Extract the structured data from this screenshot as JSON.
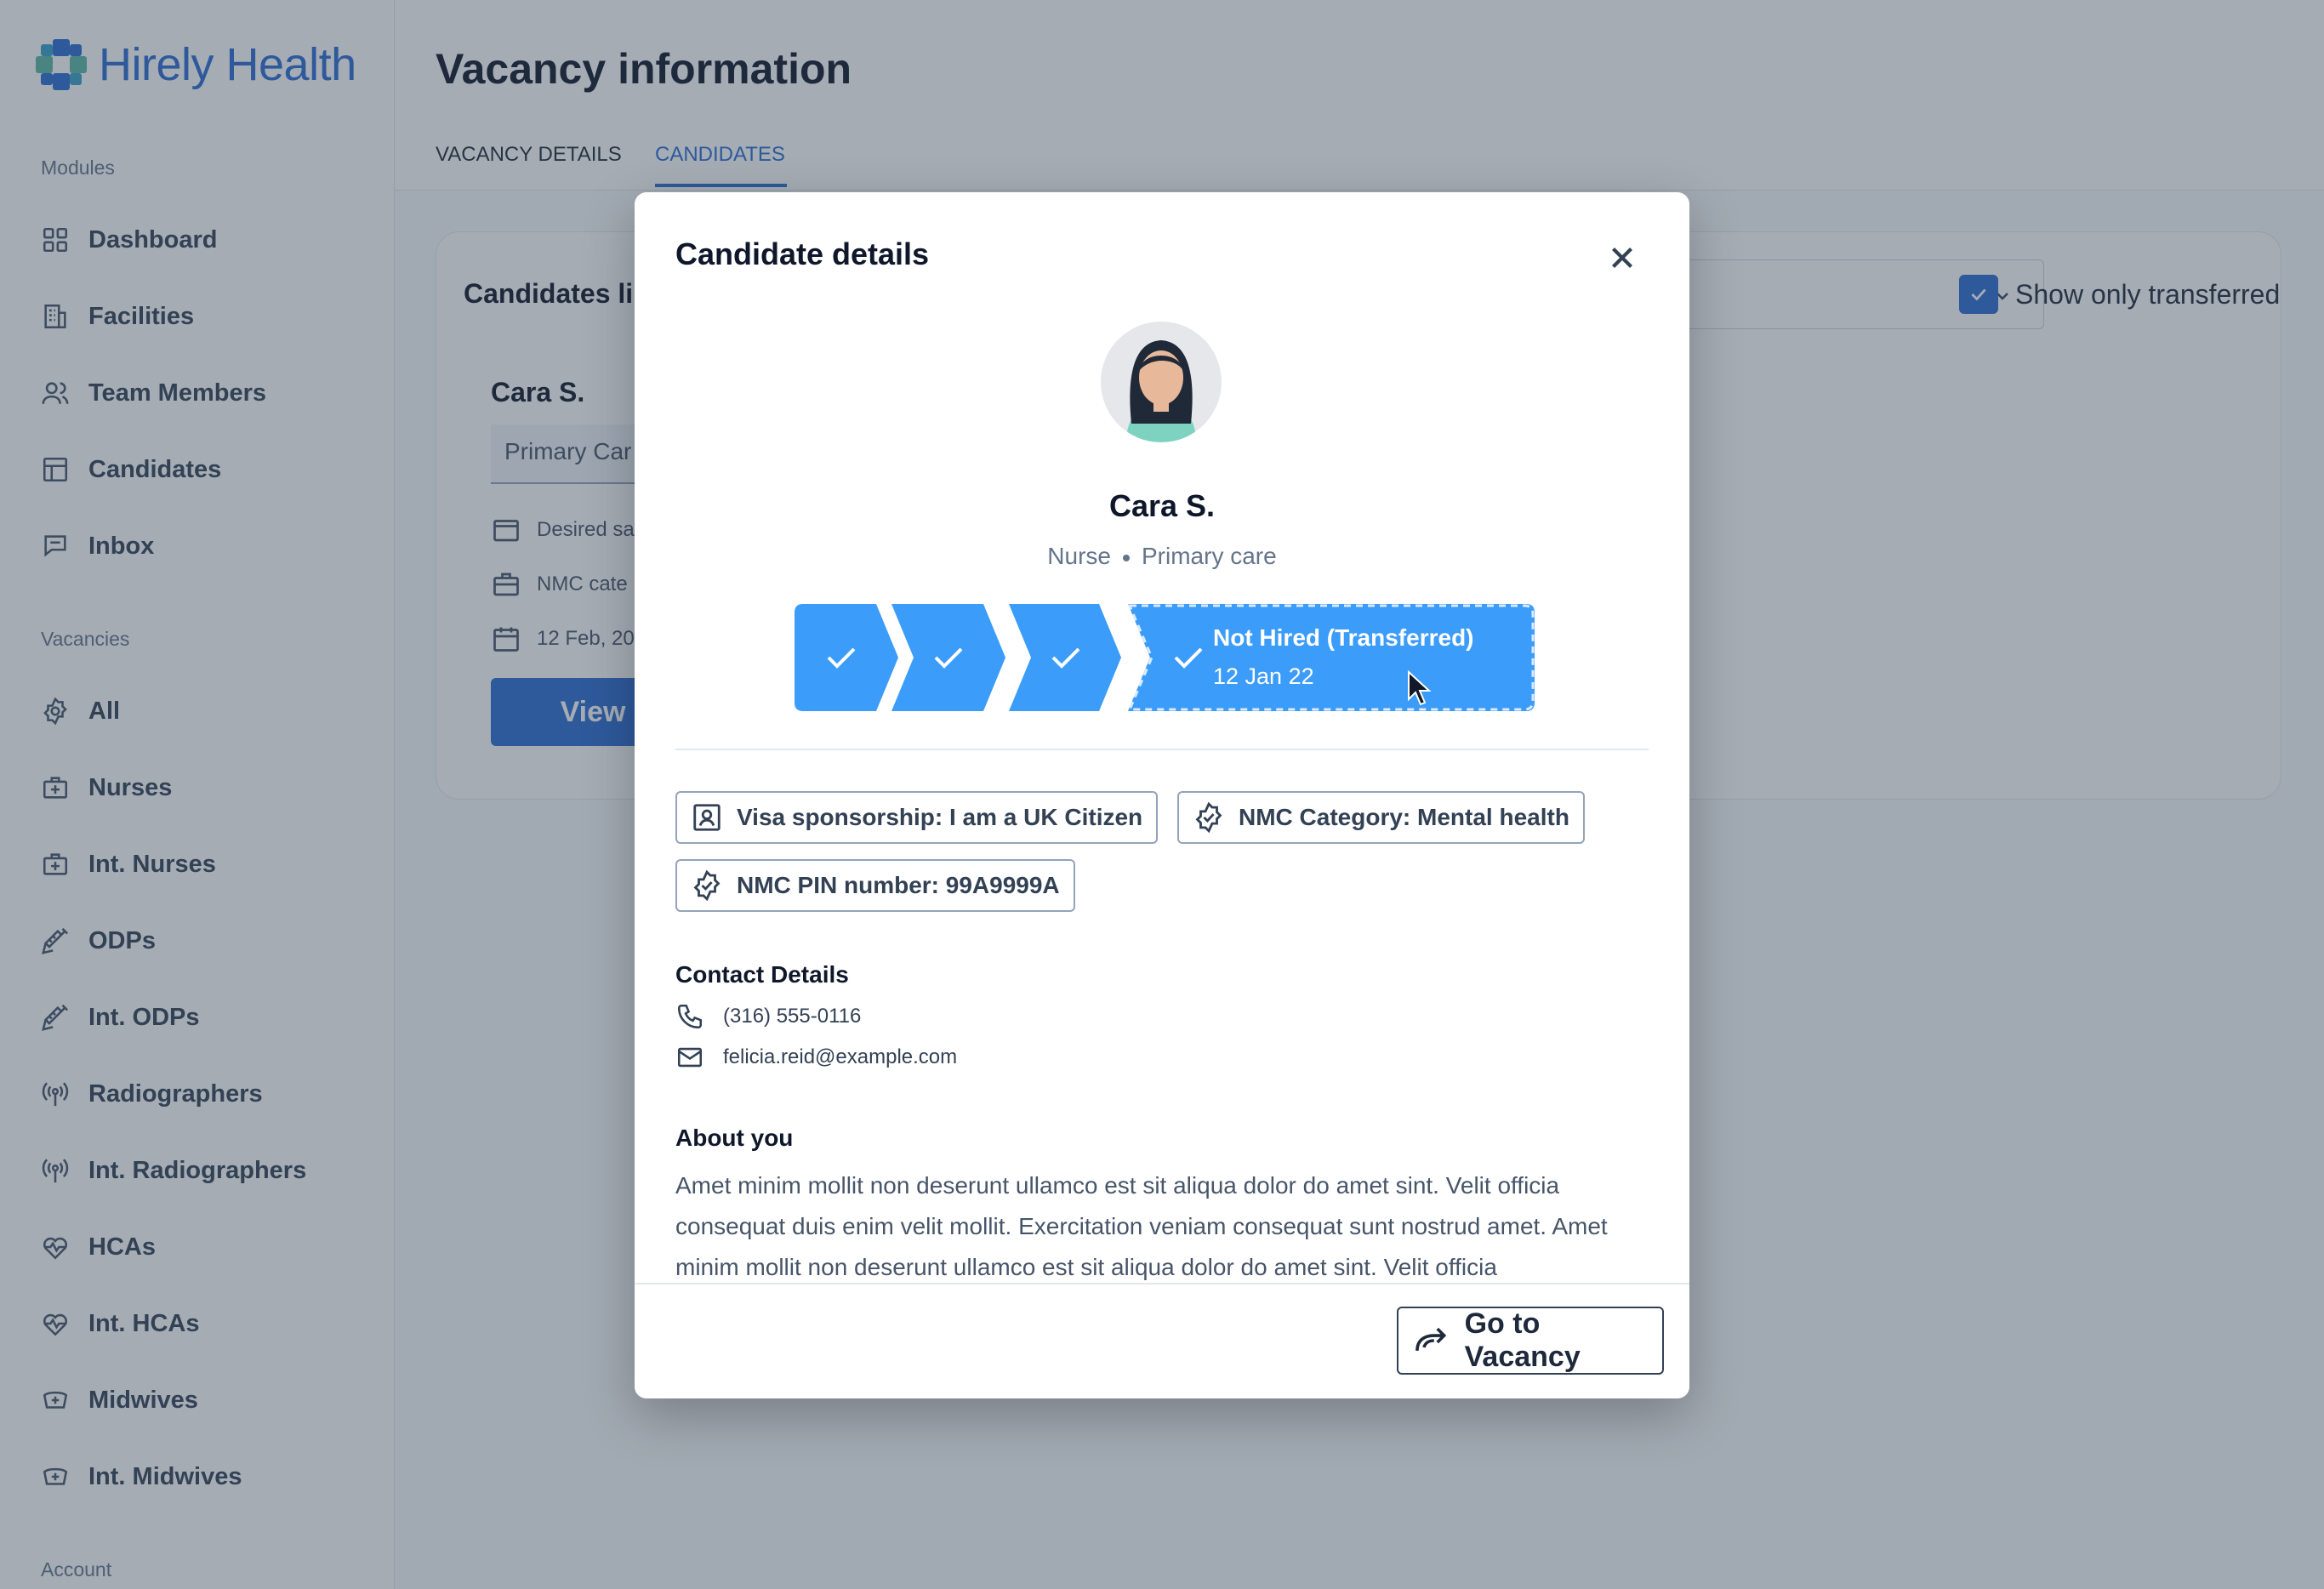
{
  "app": {
    "name": "Hirely Health"
  },
  "sidebar": {
    "modules_label": "Modules",
    "modules": [
      {
        "label": "Dashboard",
        "icon": "grid-icon"
      },
      {
        "label": "Facilities",
        "icon": "building-icon"
      },
      {
        "label": "Team Members",
        "icon": "users-icon"
      },
      {
        "label": "Candidates",
        "icon": "layout-icon"
      },
      {
        "label": "Inbox",
        "icon": "chat-icon"
      }
    ],
    "vacancies_label": "Vacancies",
    "vacancies": [
      {
        "label": "All",
        "icon": "badge-icon"
      },
      {
        "label": "Nurses",
        "icon": "medical-bag-icon"
      },
      {
        "label": "Int. Nurses",
        "icon": "medical-bag-icon"
      },
      {
        "label": "ODPs",
        "icon": "syringe-icon"
      },
      {
        "label": "Int. ODPs",
        "icon": "syringe-icon"
      },
      {
        "label": "Radiographers",
        "icon": "radio-icon"
      },
      {
        "label": "Int. Radiographers",
        "icon": "radio-icon"
      },
      {
        "label": "HCAs",
        "icon": "heart-pulse-icon"
      },
      {
        "label": "Int. HCAs",
        "icon": "heart-pulse-icon"
      },
      {
        "label": "Midwives",
        "icon": "medical-hat-icon"
      },
      {
        "label": "Int. Midwives",
        "icon": "medical-hat-icon"
      }
    ],
    "account_label": "Account"
  },
  "page": {
    "title": "Vacancy information",
    "tabs": [
      {
        "label": "VACANCY DETAILS",
        "active": false
      },
      {
        "label": "CANDIDATES",
        "active": true
      }
    ],
    "card": {
      "title": "Candidates li",
      "show_transferred_label": "Show only transferred",
      "show_transferred_checked": true,
      "candidate": {
        "name": "Cara S.",
        "tag": "Primary Car",
        "meta": [
          "Desired sa",
          "NMC cate",
          "12 Feb, 20"
        ],
        "view_label": "View"
      }
    }
  },
  "modal": {
    "title": "Candidate details",
    "name": "Cara S.",
    "role": "Nurse",
    "specialty": "Primary care",
    "progress": {
      "completed_steps": 3,
      "current_status": "Not Hired (Transferred)",
      "current_date": "12 Jan 22"
    },
    "badges": [
      {
        "icon": "id-card-icon",
        "text": "Visa sponsorship: I am a UK Citizen"
      },
      {
        "icon": "verified-badge-icon",
        "text": "NMC Category: Mental health"
      },
      {
        "icon": "verified-badge-icon",
        "text": "NMC PIN number: 99A9999A"
      }
    ],
    "contact_heading": "Contact Details",
    "phone": "(316) 555-0116",
    "email": "felicia.reid@example.com",
    "about_heading": "About you",
    "about": "Amet minim mollit non deserunt ullamco est sit aliqua dolor do amet sint. Velit officia consequat duis enim velit mollit. Exercitation veniam consequat sunt nostrud amet. Amet minim mollit non deserunt ullamco est sit aliqua dolor do amet sint. Velit officia",
    "go_button": "Go to Vacancy"
  },
  "colors": {
    "brand": "#2b6cd2",
    "progress": "#3b9cf9",
    "overlay": "rgba(51,65,85,0.44)"
  }
}
